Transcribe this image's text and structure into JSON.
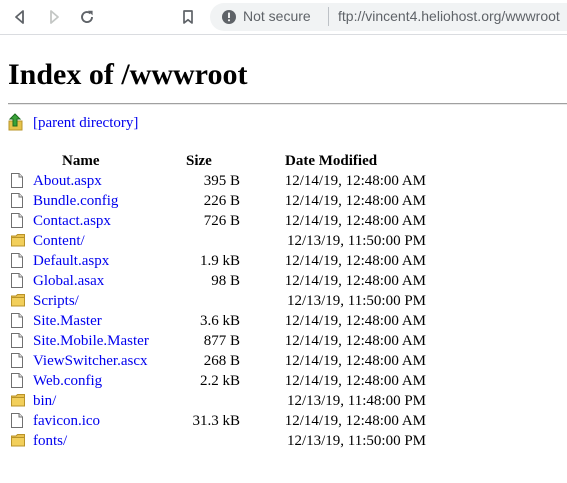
{
  "browser": {
    "security_label": "Not secure",
    "url": "ftp://vincent4.heliohost.org/wwwroot",
    "icons": {
      "back": "arrow-left-icon",
      "forward": "arrow-right-icon",
      "reload": "reload-icon",
      "bookmark": "bookmark-icon",
      "info": "info-circle-icon"
    }
  },
  "page": {
    "title": "Index of /wwwroot",
    "parent_link": "[parent directory]",
    "columns": {
      "name": "Name",
      "size": "Size",
      "date": "Date Modified"
    },
    "entries": [
      {
        "type": "file",
        "name": "About.aspx",
        "size": "395 B",
        "date": "12/14/19, 12:48:00 AM"
      },
      {
        "type": "file",
        "name": "Bundle.config",
        "size": "226 B",
        "date": "12/14/19, 12:48:00 AM"
      },
      {
        "type": "file",
        "name": "Contact.aspx",
        "size": "726 B",
        "date": "12/14/19, 12:48:00 AM"
      },
      {
        "type": "folder",
        "name": "Content/",
        "size": "",
        "date": "12/13/19, 11:50:00 PM"
      },
      {
        "type": "file",
        "name": "Default.aspx",
        "size": "1.9 kB",
        "date": "12/14/19, 12:48:00 AM"
      },
      {
        "type": "file",
        "name": "Global.asax",
        "size": "98 B",
        "date": "12/14/19, 12:48:00 AM"
      },
      {
        "type": "folder",
        "name": "Scripts/",
        "size": "",
        "date": "12/13/19, 11:50:00 PM"
      },
      {
        "type": "file",
        "name": "Site.Master",
        "size": "3.6 kB",
        "date": "12/14/19, 12:48:00 AM"
      },
      {
        "type": "file",
        "name": "Site.Mobile.Master",
        "size": "877 B",
        "date": "12/14/19, 12:48:00 AM"
      },
      {
        "type": "file",
        "name": "ViewSwitcher.ascx",
        "size": "268 B",
        "date": "12/14/19, 12:48:00 AM"
      },
      {
        "type": "file",
        "name": "Web.config",
        "size": "2.2 kB",
        "date": "12/14/19, 12:48:00 AM"
      },
      {
        "type": "folder",
        "name": "bin/",
        "size": "",
        "date": "12/13/19, 11:48:00 PM"
      },
      {
        "type": "file",
        "name": "favicon.ico",
        "size": "31.3 kB",
        "date": "12/14/19, 12:48:00 AM"
      },
      {
        "type": "folder",
        "name": "fonts/",
        "size": "",
        "date": "12/13/19, 11:50:00 PM"
      }
    ]
  }
}
